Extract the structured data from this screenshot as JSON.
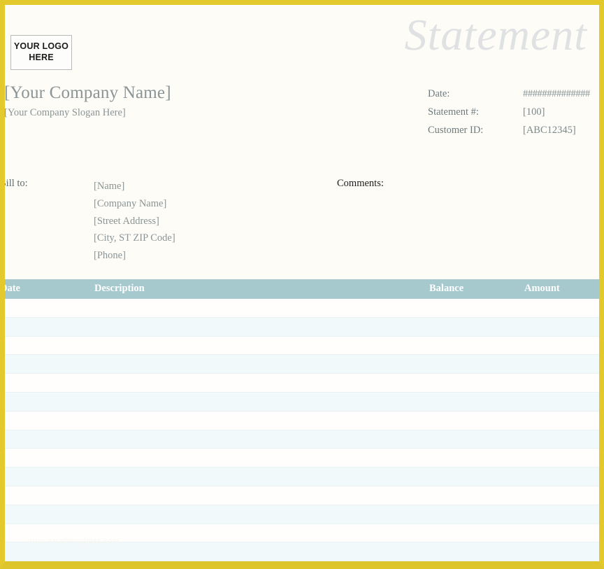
{
  "document": {
    "title": "Statement",
    "accent_border_color": "#e3c92c",
    "table_header_color": "#a6c9ce",
    "muted_text_color": "#8b9496"
  },
  "logo": {
    "line1": "YOUR LOGO",
    "line2": "HERE"
  },
  "company": {
    "name": "[Your Company Name]",
    "slogan": "[Your Company Slogan Here]"
  },
  "meta": {
    "rows": [
      {
        "label": "Date:",
        "value": "##############"
      },
      {
        "label": "Statement #:",
        "value": "[100]"
      },
      {
        "label": "Customer ID:",
        "value": "[ABC12345]"
      }
    ]
  },
  "billto": {
    "label": "Bill to:",
    "lines": [
      "[Name]",
      "[Company Name]",
      "[Street Address]",
      "[City, ST  ZIP Code]",
      "[Phone]"
    ]
  },
  "comments": {
    "label": "Comments:",
    "value": ""
  },
  "table": {
    "columns": [
      "Date",
      "Description",
      "Balance",
      "Amount"
    ],
    "rows": [
      {
        "date": "",
        "description": "",
        "balance": "",
        "amount": ""
      },
      {
        "date": "",
        "description": "",
        "balance": "",
        "amount": ""
      },
      {
        "date": "",
        "description": "",
        "balance": "",
        "amount": ""
      },
      {
        "date": "",
        "description": "",
        "balance": "",
        "amount": ""
      },
      {
        "date": "",
        "description": "",
        "balance": "",
        "amount": ""
      },
      {
        "date": "",
        "description": "",
        "balance": "",
        "amount": ""
      },
      {
        "date": "",
        "description": "",
        "balance": "",
        "amount": ""
      },
      {
        "date": "",
        "description": "",
        "balance": "",
        "amount": ""
      },
      {
        "date": "",
        "description": "",
        "balance": "",
        "amount": ""
      },
      {
        "date": "",
        "description": "",
        "balance": "",
        "amount": ""
      },
      {
        "date": "",
        "description": "",
        "balance": "",
        "amount": ""
      },
      {
        "date": "",
        "description": "",
        "balance": "",
        "amount": ""
      },
      {
        "date": "",
        "description": "",
        "balance": "",
        "amount": ""
      },
      {
        "date": "",
        "description": "",
        "balance": "",
        "amount": ""
      }
    ]
  },
  "watermark": {
    "text": "www.exceltemplates.com"
  }
}
